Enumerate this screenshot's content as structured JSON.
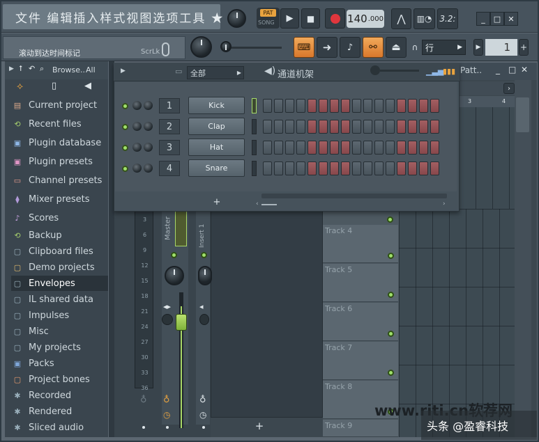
{
  "menu": {
    "title": "文件 编辑插入样式视图选项工具 ★"
  },
  "transport": {
    "pat_label": "PAT",
    "song_label": "SONG",
    "tempo_int": "140",
    "tempo_dec": ".000",
    "time_display": "3.2:"
  },
  "hint": {
    "text": "滚动到达时间标记",
    "scrlk": "ScrLk"
  },
  "snap": {
    "value": "行"
  },
  "pattern": {
    "number": "1"
  },
  "browser": {
    "header_label": "Browse..",
    "filter": "All",
    "items": [
      {
        "label": "Current project",
        "icon": "▤",
        "color": "#d9a98a"
      },
      {
        "label": "Recent files",
        "icon": "⟲",
        "color": "#a6d06d"
      },
      {
        "label": "Plugin database",
        "icon": "▣",
        "color": "#8fb7e6"
      },
      {
        "label": "Plugin presets",
        "icon": "▣",
        "color": "#e195c6"
      },
      {
        "label": "Channel presets",
        "icon": "▭",
        "color": "#e59b8d"
      },
      {
        "label": "Mixer presets",
        "icon": "⧫",
        "color": "#b19ad9"
      },
      {
        "label": "Scores",
        "icon": "♪",
        "color": "#c8a3e3"
      },
      {
        "label": "Backup",
        "icon": "⟲",
        "color": "#a6d06d"
      },
      {
        "label": "Clipboard files",
        "icon": "▢",
        "color": "#9ab0bc"
      },
      {
        "label": "Demo projects",
        "icon": "▢",
        "color": "#e0b96d"
      },
      {
        "label": "Envelopes",
        "icon": "▢",
        "color": "#9ab0bc"
      },
      {
        "label": "IL shared data",
        "icon": "▢",
        "color": "#9ab0bc"
      },
      {
        "label": "Impulses",
        "icon": "▢",
        "color": "#9ab0bc"
      },
      {
        "label": "Misc",
        "icon": "▢",
        "color": "#9ab0bc"
      },
      {
        "label": "My projects",
        "icon": "▢",
        "color": "#9ab0bc"
      },
      {
        "label": "Packs",
        "icon": "▣",
        "color": "#7fa7d9"
      },
      {
        "label": "Project bones",
        "icon": "▢",
        "color": "#e59b6d"
      },
      {
        "label": "Recorded",
        "icon": "✱",
        "color": "#9ab0bc"
      },
      {
        "label": "Rendered",
        "icon": "✱",
        "color": "#9ab0bc"
      },
      {
        "label": "Sliced audio",
        "icon": "✱",
        "color": "#9ab0bc"
      }
    ]
  },
  "rack": {
    "filter": "全部",
    "title": "通道机架",
    "add_label": "+",
    "channels": [
      {
        "num": "1",
        "name": "Kick"
      },
      {
        "num": "2",
        "name": "Clap"
      },
      {
        "num": "3",
        "name": "Hat"
      },
      {
        "num": "4",
        "name": "Snare"
      }
    ]
  },
  "mixer": {
    "scale": [
      "3",
      "6",
      "9",
      "12",
      "15",
      "18",
      "21",
      "24",
      "27",
      "30",
      "33",
      "36"
    ],
    "master_label": "Master",
    "insert_label": "Insert 1"
  },
  "playlist": {
    "title": "Patt..",
    "ruler": [
      "3",
      "4"
    ],
    "tracks": [
      "Track 4",
      "Track 5",
      "Track 6",
      "Track 7",
      "Track 8",
      "Track 9"
    ],
    "add_label": "+"
  },
  "watermark": {
    "site": "www.riti.cn软荐网",
    "brand": "头条 @盈睿科技"
  }
}
